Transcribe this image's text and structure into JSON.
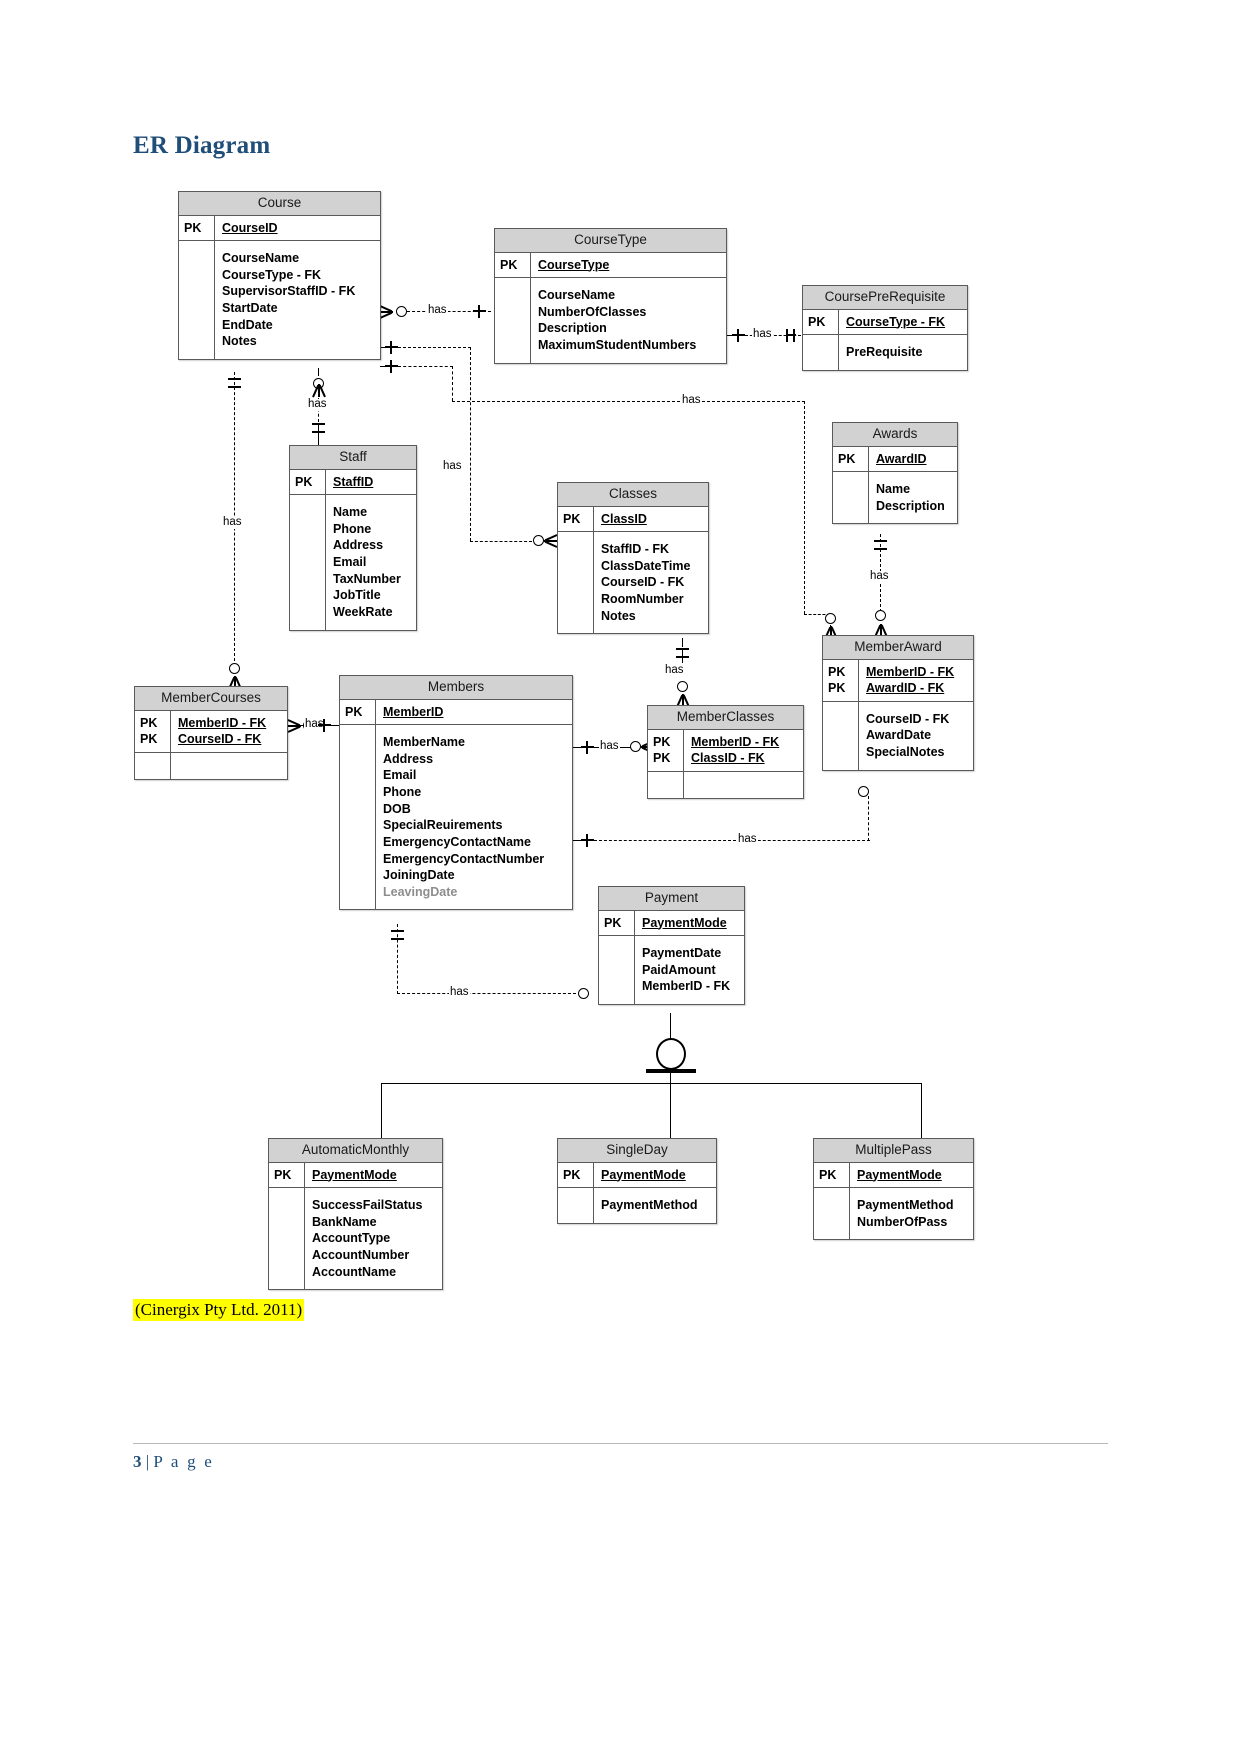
{
  "document": {
    "heading": "ER Diagram",
    "citation": "(Cinergix Pty Ltd. 2011)",
    "footer": {
      "page_number": "3",
      "separator": "|",
      "label": "P a g e"
    }
  },
  "diagram": {
    "type": "entity-relationship",
    "relationship_label": "has",
    "entities": [
      {
        "name": "Course",
        "keys": [
          "PK"
        ],
        "key_attributes": [
          "CourseID"
        ],
        "attributes": [
          "CourseName",
          "CourseType - FK",
          "SupervisorStaffID - FK",
          "StartDate",
          "EndDate",
          "Notes"
        ]
      },
      {
        "name": "CourseType",
        "keys": [
          "PK"
        ],
        "key_attributes": [
          "CourseType"
        ],
        "attributes": [
          "CourseName",
          "NumberOfClasses",
          "Description",
          "MaximumStudentNumbers"
        ]
      },
      {
        "name": "CoursePreRequisite",
        "keys": [
          "PK"
        ],
        "key_attributes": [
          "CourseType - FK"
        ],
        "attributes": [
          "PreRequisite"
        ]
      },
      {
        "name": "Staff",
        "keys": [
          "PK"
        ],
        "key_attributes": [
          "StaffID"
        ],
        "attributes": [
          "Name",
          "Phone",
          "Address",
          "Email",
          "TaxNumber",
          "JobTitle",
          "WeekRate"
        ]
      },
      {
        "name": "Classes",
        "keys": [
          "PK"
        ],
        "key_attributes": [
          "ClassID"
        ],
        "attributes": [
          "StaffID - FK",
          "ClassDateTime",
          "CourseID - FK",
          "RoomNumber",
          "Notes"
        ]
      },
      {
        "name": "Awards",
        "keys": [
          "PK"
        ],
        "key_attributes": [
          "AwardID"
        ],
        "attributes": [
          "Name",
          "Description"
        ]
      },
      {
        "name": "MemberCourses",
        "keys": [
          "PK",
          "PK"
        ],
        "key_attributes": [
          "MemberID - FK",
          "CourseID - FK"
        ],
        "attributes": []
      },
      {
        "name": "Members",
        "keys": [
          "PK"
        ],
        "key_attributes": [
          "MemberID"
        ],
        "attributes": [
          "MemberName",
          "Address",
          "Email",
          "Phone",
          "DOB",
          "SpecialReuirements",
          "EmergencyContactName",
          "EmergencyContactNumber",
          "JoiningDate",
          "LeavingDate"
        ]
      },
      {
        "name": "MemberClasses",
        "keys": [
          "PK",
          "PK"
        ],
        "key_attributes": [
          "MemberID - FK",
          "ClassID - FK"
        ],
        "attributes": []
      },
      {
        "name": "MemberAward",
        "keys": [
          "PK",
          "PK"
        ],
        "key_attributes": [
          "MemberID - FK",
          "AwardID - FK"
        ],
        "attributes": [
          "CourseID - FK",
          "AwardDate",
          "SpecialNotes"
        ]
      },
      {
        "name": "Payment",
        "keys": [
          "PK"
        ],
        "key_attributes": [
          "PaymentMode"
        ],
        "attributes": [
          "PaymentDate",
          "PaidAmount",
          "MemberID - FK"
        ]
      },
      {
        "name": "AutomaticMonthly",
        "keys": [
          "PK"
        ],
        "key_attributes": [
          "PaymentMode"
        ],
        "attributes": [
          "SuccessFailStatus",
          "BankName",
          "AccountType",
          "AccountNumber",
          "AccountName"
        ]
      },
      {
        "name": "SingleDay",
        "keys": [
          "PK"
        ],
        "key_attributes": [
          "PaymentMode"
        ],
        "attributes": [
          "PaymentMethod"
        ]
      },
      {
        "name": "MultiplePass",
        "keys": [
          "PK"
        ],
        "key_attributes": [
          "PaymentMode"
        ],
        "attributes": [
          "PaymentMethod",
          "NumberOfPass"
        ]
      }
    ],
    "relationships": [
      {
        "from": "Course",
        "to": "CourseType",
        "label": "has"
      },
      {
        "from": "CourseType",
        "to": "CoursePreRequisite",
        "label": "has"
      },
      {
        "from": "Course",
        "to": "Staff",
        "label": "has"
      },
      {
        "from": "Course",
        "to": "Classes",
        "label": "has"
      },
      {
        "from": "Course",
        "to": "MemberCourses",
        "label": "has"
      },
      {
        "from": "Course",
        "to": "MemberAward",
        "label": "has"
      },
      {
        "from": "Classes",
        "to": "MemberClasses",
        "label": "has"
      },
      {
        "from": "Awards",
        "to": "MemberAward",
        "label": "has"
      },
      {
        "from": "Members",
        "to": "MemberCourses",
        "label": "has"
      },
      {
        "from": "Members",
        "to": "MemberClasses",
        "label": "has"
      },
      {
        "from": "Members",
        "to": "MemberAward",
        "label": "has"
      },
      {
        "from": "Members",
        "to": "Payment",
        "label": "has"
      }
    ],
    "generalization": {
      "supertype": "Payment",
      "subtypes": [
        "AutomaticMonthly",
        "SingleDay",
        "MultiplePass"
      ]
    },
    "colors": {
      "header_fill": "#d2d2d2",
      "border": "#5a5a5a",
      "heading": "#1f4e79",
      "highlight": "#ffff00"
    }
  }
}
